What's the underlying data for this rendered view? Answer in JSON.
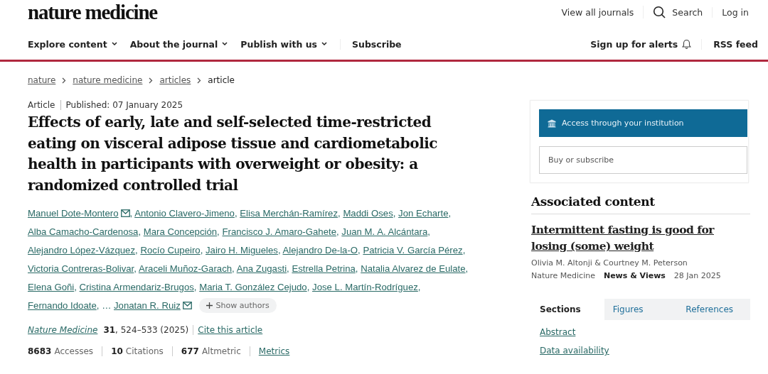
{
  "header": {
    "logo": "nature medicine",
    "top_links": [
      {
        "label": "View all journals",
        "kind": "text"
      },
      {
        "label": "Search",
        "kind": "search"
      },
      {
        "label": "Log in",
        "kind": "text"
      }
    ]
  },
  "nav": {
    "items": [
      {
        "label": "Explore content",
        "dropdown": true
      },
      {
        "label": "About the journal",
        "dropdown": true
      },
      {
        "label": "Publish with us",
        "dropdown": true
      },
      {
        "label": "Subscribe",
        "dropdown": false
      }
    ],
    "right": [
      {
        "label": "Sign up for alerts",
        "kind": "alerts"
      },
      {
        "label": "RSS feed",
        "kind": "text"
      }
    ]
  },
  "breadcrumb": [
    {
      "label": "nature",
      "link": true
    },
    {
      "label": "nature medicine",
      "link": true
    },
    {
      "label": "articles",
      "link": true
    },
    {
      "label": "article",
      "link": false
    }
  ],
  "article": {
    "type": "Article",
    "published": "Published: 07 January 2025",
    "title": "Effects of early, late and self-selected time-restricted eating on visceral adipose tissue and cardiometabolic health in participants with overweight or obesity: a randomized controlled trial",
    "separator": ",",
    "authors": [
      {
        "name": "Manuel Dote-Montero",
        "email": true
      },
      {
        "name": "Antonio Clavero-Jimeno",
        "email": false
      },
      {
        "name": "Elisa Merchán-Ramírez",
        "email": false
      },
      {
        "name": "Maddi Oses",
        "email": false
      },
      {
        "name": "Jon Echarte",
        "email": false
      },
      {
        "name": "Alba Camacho-Cardenosa",
        "email": false
      },
      {
        "name": "Mara Concepción",
        "email": false
      },
      {
        "name": "Francisco J. Amaro-Gahete",
        "email": false
      },
      {
        "name": "Juan M. A. Alcántara",
        "email": false
      },
      {
        "name": "Alejandro López-Vázquez",
        "email": false
      },
      {
        "name": "Rocío Cupeiro",
        "email": false
      },
      {
        "name": "Jairo H. Migueles",
        "email": false
      },
      {
        "name": "Alejandro De-la-O",
        "email": false
      },
      {
        "name": "Patricia V. García Pérez",
        "email": false
      },
      {
        "name": "Victoria Contreras-Bolivar",
        "email": false
      },
      {
        "name": "Araceli Muñoz-Garach",
        "email": false
      },
      {
        "name": "Ana Zugasti",
        "email": false
      },
      {
        "name": "Estrella Petrina",
        "email": false
      },
      {
        "name": "Natalia Alvarez de Eulate",
        "email": false
      },
      {
        "name": "Elena Goñi",
        "email": false
      },
      {
        "name": "Cristina Armendariz-Brugos",
        "email": false
      },
      {
        "name": "Maria T. González Cejudo",
        "email": false
      },
      {
        "name": "Jose L. Martín-Rodríguez",
        "email": false
      },
      {
        "name": "Fernando Idoate",
        "email": false
      }
    ],
    "ellipsis": "…",
    "last_author": {
      "name": "Jonatan R. Ruiz",
      "email": true
    },
    "show_authors": "Show authors",
    "citation": {
      "journal": "Nature Medicine",
      "volume": "31",
      "pages": ", 524–533 (2025)",
      "cite": "Cite this article"
    },
    "metrics": [
      {
        "value": "8683",
        "label": "Accesses"
      },
      {
        "value": "10",
        "label": "Citations"
      },
      {
        "value": "677",
        "label": "Altmetric"
      }
    ],
    "metrics_link": "Metrics"
  },
  "access": {
    "institution": "Access through your institution",
    "buy": "Buy or subscribe"
  },
  "associated": {
    "heading": "Associated content",
    "title": "Intermittent fasting is good for losing (some) weight",
    "authors": "Olivia M. Altonji & Courtney M. Peterson",
    "journal": "Nature Medicine",
    "type": "News & Views",
    "date": "28 Jan 2025"
  },
  "sections_tabs": [
    {
      "label": "Sections",
      "selected": true
    },
    {
      "label": "Figures",
      "selected": false
    },
    {
      "label": "References",
      "selected": false
    }
  ],
  "section_links": [
    "Abstract",
    "Data availability"
  ]
}
